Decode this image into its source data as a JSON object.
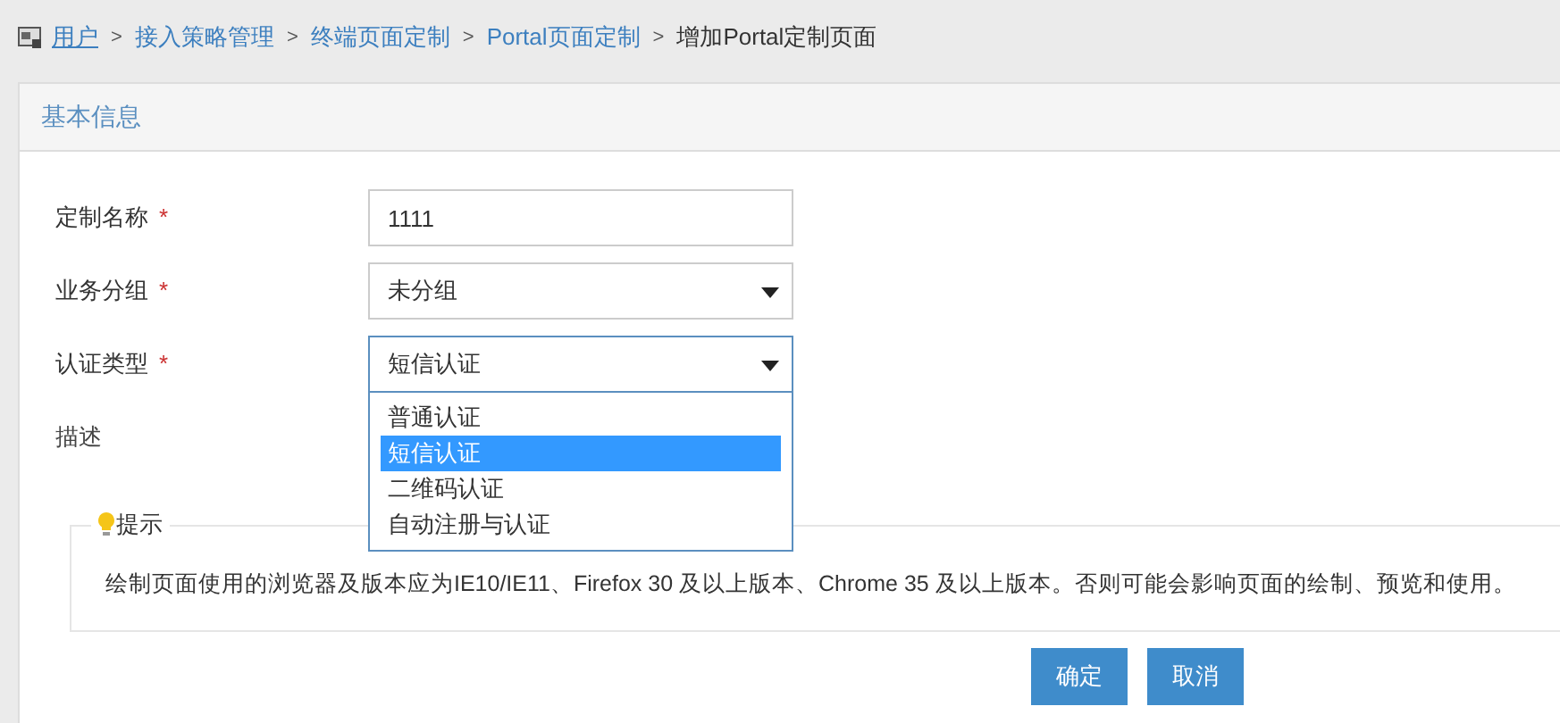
{
  "breadcrumb": [
    {
      "label": "用户",
      "kind": "link",
      "underline": true
    },
    {
      "label": "接入策略管理",
      "kind": "link",
      "underline": false
    },
    {
      "label": "终端页面定制",
      "kind": "link",
      "underline": false
    },
    {
      "label": "Portal页面定制",
      "kind": "link",
      "underline": false
    },
    {
      "label": "增加Portal定制页面",
      "kind": "current",
      "underline": false
    }
  ],
  "breadcrumb_separator": ">",
  "panel": {
    "title": "基本信息"
  },
  "form": [
    {
      "label": "定制名称",
      "required": true,
      "kind": "text",
      "value": "1111"
    },
    {
      "label": "业务分组",
      "required": true,
      "kind": "select",
      "value": "未分组"
    },
    {
      "label": "认证类型",
      "required": true,
      "kind": "select",
      "value": "短信认证",
      "expanded": true,
      "options": [
        {
          "label": "普通认证",
          "selected": false
        },
        {
          "label": "短信认证",
          "selected": true
        },
        {
          "label": "二维码认证",
          "selected": false
        },
        {
          "label": "自动注册与认证",
          "selected": false
        }
      ]
    },
    {
      "label": "描述",
      "required": false,
      "kind": "none"
    }
  ],
  "required_mark": "*",
  "hint": {
    "title": "提示",
    "text": "绘制页面使用的浏览器及版本应为IE10/IE11、Firefox 30 及以上版本、Chrome 35 及以上版本。否则可能会影响页面的绘制、预览和使用。"
  },
  "buttons": [
    "确定",
    "取消"
  ]
}
